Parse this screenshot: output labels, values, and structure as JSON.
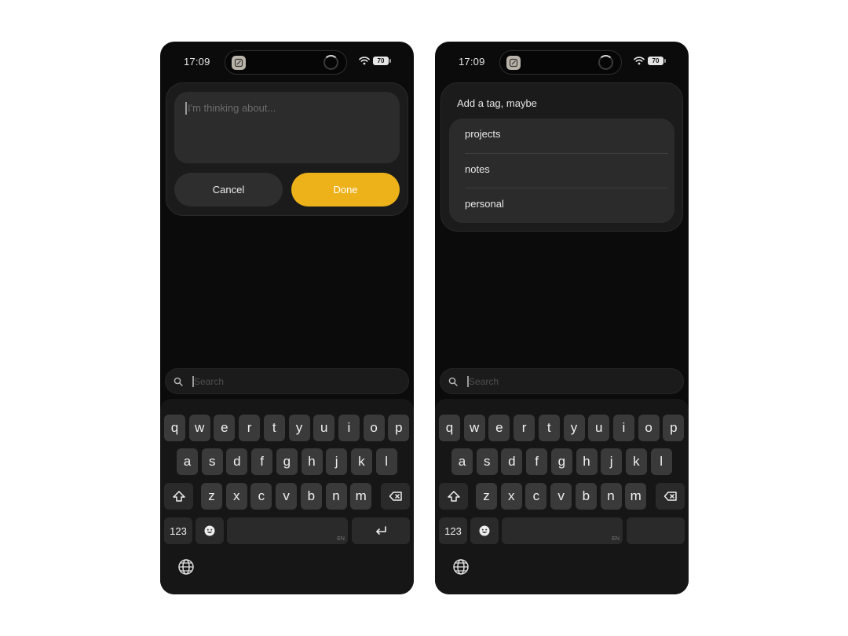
{
  "status": {
    "time": "17:09",
    "battery": "70"
  },
  "screens": [
    {
      "compose": {
        "placeholder": "I'm thinking about...",
        "cancel_label": "Cancel",
        "done_label": "Done"
      },
      "search": {
        "placeholder": "Search"
      },
      "keyboard_return": "enabled"
    },
    {
      "tags": {
        "title": "Add a tag, maybe",
        "items": [
          "projects",
          "notes",
          "personal"
        ]
      },
      "search": {
        "placeholder": "Search"
      },
      "keyboard_return": "dimmed"
    }
  ],
  "keyboard": {
    "row1": [
      "q",
      "w",
      "e",
      "r",
      "t",
      "y",
      "u",
      "i",
      "o",
      "p"
    ],
    "row2": [
      "a",
      "s",
      "d",
      "f",
      "g",
      "h",
      "j",
      "k",
      "l"
    ],
    "row3": [
      "z",
      "x",
      "c",
      "v",
      "b",
      "n",
      "m"
    ],
    "numbers_label": "123",
    "lang_label": "EN"
  },
  "icons": {
    "shift": "shift-icon",
    "backspace": "backspace-icon",
    "emoji": "emoji-icon",
    "return": "return-icon",
    "globe": "globe-icon",
    "search": "search-icon",
    "wifi": "wifi-icon"
  },
  "colors": {
    "accent": "#edb21a",
    "background": "#0b0b0b",
    "card": "#1b1b1b",
    "key": "#3a3a3a"
  }
}
